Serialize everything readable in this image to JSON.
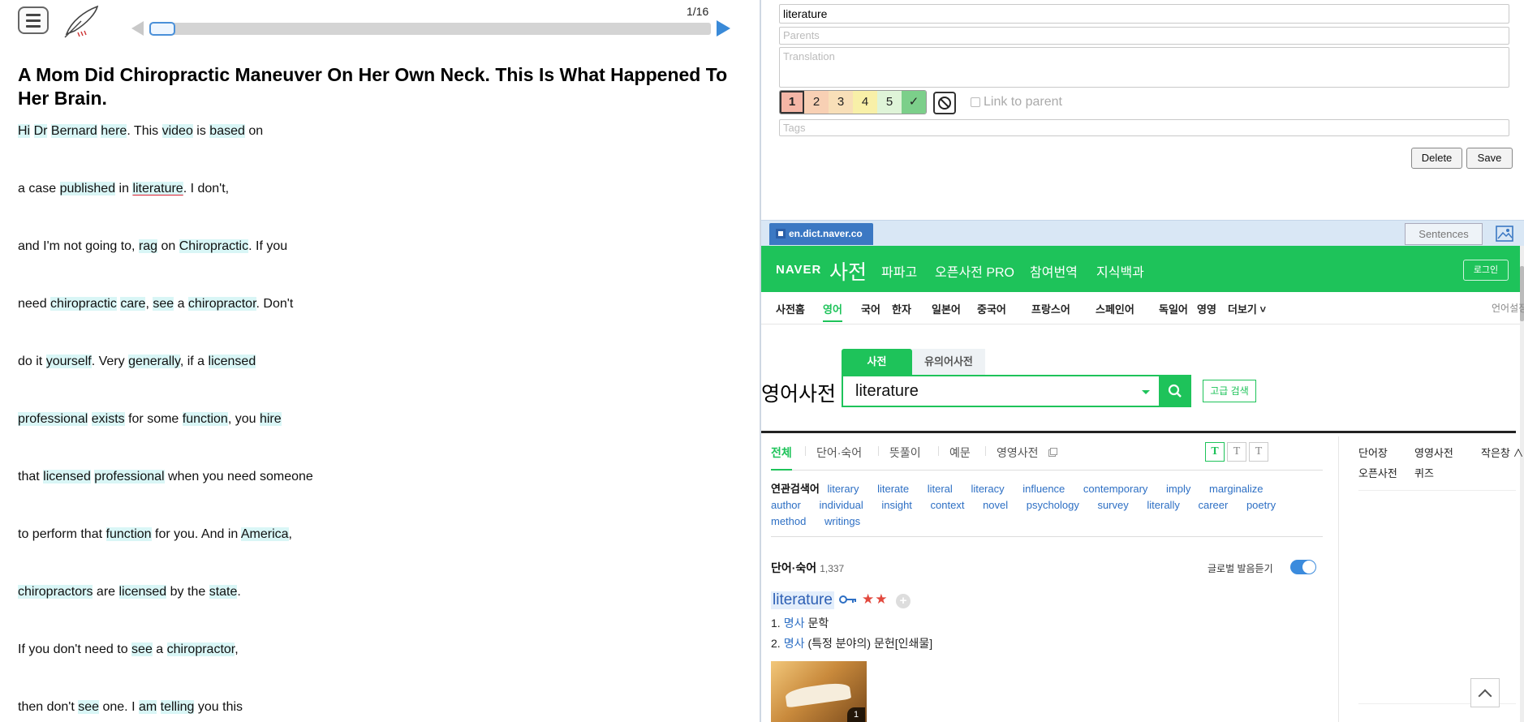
{
  "reader": {
    "pager": "1/16",
    "progress_fraction": 0.0,
    "title": "A Mom Did Chiropractic Maneuver On Her Own Neck. This Is What Happened To Her Brain.",
    "paragraphs": [
      [
        [
          "Hi",
          1
        ],
        [
          " ",
          0
        ],
        [
          "Dr",
          1
        ],
        [
          " ",
          0
        ],
        [
          "Bernard",
          1
        ],
        [
          " ",
          0
        ],
        [
          "here",
          1
        ],
        [
          ". This ",
          0
        ],
        [
          "video",
          1
        ],
        [
          " is ",
          0
        ],
        [
          "based",
          1
        ],
        [
          " on",
          0
        ]
      ],
      [
        [
          "a case ",
          0
        ],
        [
          "published",
          1
        ],
        [
          " in ",
          0
        ],
        [
          "literature",
          2
        ],
        [
          ". I don't,",
          0
        ]
      ],
      [
        [
          "and I'm not going to, ",
          0
        ],
        [
          "rag",
          1
        ],
        [
          " on ",
          0
        ],
        [
          "Chiropractic",
          1
        ],
        [
          ". If you",
          0
        ]
      ],
      [
        [
          "need ",
          0
        ],
        [
          "chiropractic",
          1
        ],
        [
          " ",
          0
        ],
        [
          "care",
          1
        ],
        [
          ", ",
          0
        ],
        [
          "see",
          1
        ],
        [
          " a ",
          0
        ],
        [
          "chiropractor",
          1
        ],
        [
          ". Don't",
          0
        ]
      ],
      [
        [
          "do it ",
          0
        ],
        [
          "yourself",
          1
        ],
        [
          ". Very ",
          0
        ],
        [
          "generally",
          1
        ],
        [
          ", if a ",
          0
        ],
        [
          "licensed",
          1
        ]
      ],
      [
        [
          "professional",
          1
        ],
        [
          " ",
          0
        ],
        [
          "exists",
          1
        ],
        [
          " for some ",
          0
        ],
        [
          "function",
          1
        ],
        [
          ", you ",
          0
        ],
        [
          "hire",
          1
        ]
      ],
      [
        [
          "that ",
          0
        ],
        [
          "licensed",
          1
        ],
        [
          " ",
          0
        ],
        [
          "professional",
          1
        ],
        [
          " when you need someone",
          0
        ]
      ],
      [
        [
          "to perform that ",
          0
        ],
        [
          "function",
          1
        ],
        [
          " for you. And in ",
          0
        ],
        [
          "America",
          1
        ],
        [
          ",",
          0
        ]
      ],
      [
        [
          "chiropractors",
          1
        ],
        [
          " are ",
          0
        ],
        [
          "licensed",
          1
        ],
        [
          " by the ",
          0
        ],
        [
          "state",
          1
        ],
        [
          ".",
          0
        ]
      ],
      [
        [
          "If you don't need to ",
          0
        ],
        [
          "see",
          1
        ],
        [
          " a ",
          0
        ],
        [
          "chiropractor",
          1
        ],
        [
          ",",
          0
        ]
      ],
      [
        [
          "then don't ",
          0
        ],
        [
          "see",
          1
        ],
        [
          " one. I ",
          0
        ],
        [
          "am",
          1
        ],
        [
          " ",
          0
        ],
        [
          "telling",
          1
        ],
        [
          " you this",
          0
        ]
      ]
    ]
  },
  "editor": {
    "word": "literature",
    "parents_placeholder": "Parents",
    "translation_placeholder": "Translation",
    "tags_placeholder": "Tags",
    "levels": [
      {
        "label": "1",
        "color": "#f4b6a6",
        "selected": true
      },
      {
        "label": "2",
        "color": "#f8d0b4",
        "selected": false
      },
      {
        "label": "3",
        "color": "#f8dfb8",
        "selected": false
      },
      {
        "label": "4",
        "color": "#f8f0a8",
        "selected": false
      },
      {
        "label": "5",
        "color": "#dff4d8",
        "selected": false
      },
      {
        "label": "✓",
        "color": "#7ccf8a",
        "selected": false
      }
    ],
    "link_to_parent": "Link to parent",
    "delete_label": "Delete",
    "save_label": "Save"
  },
  "browser": {
    "tab_label": "en.dict.naver.co",
    "sentences_label": "Sentences"
  },
  "naver": {
    "logo": "NAVER",
    "dict": "사전",
    "menu": [
      "파파고",
      "오픈사전 PRO",
      "참여번역",
      "지식백과"
    ],
    "login": "로그인",
    "langs": [
      "사전홈",
      "영어",
      "국어",
      "한자",
      "일본어",
      "중국어",
      "프랑스어",
      "스페인어",
      "독일어",
      "영영",
      "더보기 ˅"
    ],
    "lang_setting": "언어설정",
    "section_title": "영어사전",
    "search_tab_on": "사전",
    "search_tab_off": "유의어사전",
    "search_value": "literature",
    "advanced": "고급 검색",
    "result_tabs": [
      "전체",
      "단어·숙어",
      "뜻풀이",
      "예문",
      "영영사전"
    ],
    "related_label": "연관검색어",
    "related": [
      "literary",
      "literate",
      "literal",
      "literacy",
      "influence",
      "contemporary",
      "imply",
      "marginalize",
      "author",
      "individual",
      "insight",
      "context",
      "novel",
      "psychology",
      "survey",
      "literally",
      "career",
      "poetry",
      "method",
      "writings"
    ],
    "word_section": "단어·숙어",
    "word_count": "1,337",
    "global_pron": "글로벌 발음듣기",
    "entry": "literature",
    "stars": "★★",
    "senses": [
      {
        "num": "1.",
        "pos": "명사",
        "text": "문학"
      },
      {
        "num": "2.",
        "pos": "명사",
        "text": "(특정 분야의) 문헌[인쇄물]"
      }
    ],
    "image_badge": "1",
    "side_links": [
      "단어장",
      "영영사전",
      "작은창 ∧",
      "오픈사전",
      "퀴즈"
    ]
  }
}
